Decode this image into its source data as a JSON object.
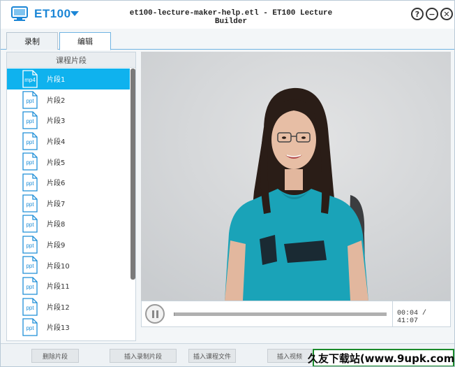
{
  "app": {
    "brand": "ET100",
    "window_title": "et100-lecture-maker-help.etl - ET100 Lecture Builder",
    "help_label": "?",
    "minimize_label": "−",
    "close_label": "✕"
  },
  "tabs": [
    {
      "label": "录制",
      "active": false
    },
    {
      "label": "编辑",
      "active": true
    }
  ],
  "segment_panel": {
    "header": "课程片段",
    "items": [
      {
        "ext": "mp4",
        "label": "片段1",
        "selected": true
      },
      {
        "ext": "ppt",
        "label": "片段2"
      },
      {
        "ext": "ppt",
        "label": "片段3"
      },
      {
        "ext": "ppt",
        "label": "片段4"
      },
      {
        "ext": "ppt",
        "label": "片段5"
      },
      {
        "ext": "ppt",
        "label": "片段6"
      },
      {
        "ext": "ppt",
        "label": "片段7"
      },
      {
        "ext": "ppt",
        "label": "片段8"
      },
      {
        "ext": "ppt",
        "label": "片段9"
      },
      {
        "ext": "ppt",
        "label": "片段10"
      },
      {
        "ext": "ppt",
        "label": "片段11"
      },
      {
        "ext": "ppt",
        "label": "片段12"
      },
      {
        "ext": "ppt",
        "label": "片段13"
      }
    ]
  },
  "player": {
    "current_time": "00:04",
    "total_time": "41:07",
    "time_display": "00:04 / 41:07",
    "progress_fraction": 0.0016
  },
  "toolbar": {
    "delete_segment": "删除片段",
    "insert_recorded": "插入录制片段",
    "insert_course_file": "插入课程文件",
    "insert_video": "插入视频"
  },
  "watermark": {
    "text": "久友下载站(www.9upk.com)"
  },
  "colors": {
    "accent": "#1b86d6",
    "selection": "#0fb2ee",
    "tab_border": "#6fb3e2",
    "shirt": "#1aa3b8",
    "watermark_border": "#1a8a2a"
  },
  "icons": {
    "logo": "et100-logo-icon",
    "play_pause": "pause-icon",
    "file": "file-icon"
  }
}
